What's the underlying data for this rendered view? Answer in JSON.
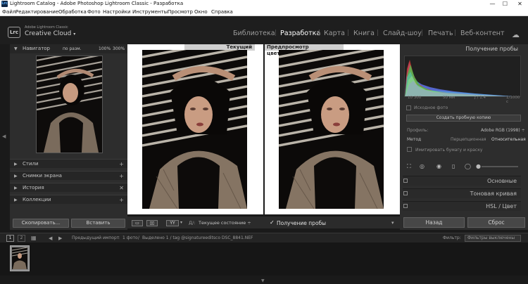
{
  "titlebar": {
    "app_icon": "Lrc",
    "title": "Lightroom Catalog - Adobe Photoshop Lightroom Classic - Разработка",
    "minimize": "—",
    "maximize": "☐",
    "close": "✕"
  },
  "menu": [
    "Файл",
    "Редактирование",
    "Обработка",
    "Фото",
    "Настройки",
    "Инструменты",
    "Просмотр",
    "Окно",
    "Справка"
  ],
  "identity": {
    "logo": "Lrc",
    "brand_top": "Adobe Lightroom Classic",
    "brand_main": "Creative Cloud",
    "brand_arrow": "▾",
    "modules": [
      "Библиотека",
      "Разработка",
      "Карта",
      "Книга",
      "Слайд-шоу",
      "Печать",
      "Веб-контент"
    ],
    "active_module": "Разработка",
    "identity_icon": "cloud-icon"
  },
  "left": {
    "navigator": {
      "title": "Навигатор",
      "fit": "по разм.",
      "zoom1": "100%",
      "zoom2": "300%"
    },
    "sections": [
      {
        "label": "Стили",
        "action": "+"
      },
      {
        "label": "Снимки экрана",
        "action": "+"
      },
      {
        "label": "История",
        "action": "✕"
      },
      {
        "label": "Коллекции",
        "action": "+"
      }
    ],
    "copy_button": "Скопировать...",
    "paste_button": "Вставить"
  },
  "center": {
    "label_current": "Текущий",
    "label_proof": "Предпросмотр цветопробы"
  },
  "toolbar": {
    "compare_label": "YY",
    "before_after": "Д/:",
    "state_value": "Текущее состояние",
    "proof_check": "✓",
    "proof_label": "Получение пробы"
  },
  "right": {
    "title": "Получение пробы",
    "hist_info": [
      "10 300",
      "50 мм",
      "ƒ / 1.4",
      "1/1000 с"
    ],
    "source_photo": "Исходное фото",
    "create_proof": "Создать пробную копию",
    "profile_label": "Профиль:",
    "profile_value": "Adobe RGB (1998) ÷",
    "method_label": "Метод",
    "method_perceptual": "Перцепционная",
    "method_relative": "Относительная",
    "simulate_paper": "Имитировать бумагу и краску",
    "sections": [
      "Основные",
      "Тоновая кривая",
      "HSL / Цвет"
    ],
    "prev_button": "Назад",
    "reset_button": "Сброс"
  },
  "filmstrip": {
    "page1": "1",
    "page2": "2",
    "prev_import": "Предыдущий импорт",
    "count": "1 фото",
    "selected": "Выделено 1 / tag @signatureeditsco DSC_8841.NEF",
    "filter_label": "Фильтр:",
    "filter_value": "Фильтры выключены"
  },
  "colors": {
    "accent_white": "#ffffff",
    "panel": "#2d2d2d",
    "background": "#1a1a1a"
  }
}
